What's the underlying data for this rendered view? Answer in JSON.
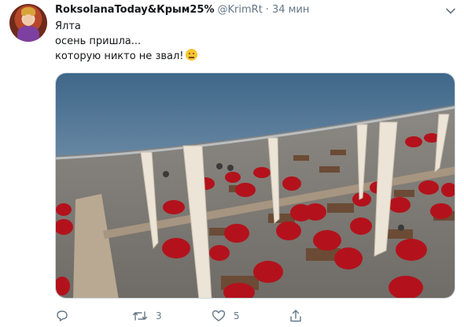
{
  "author": {
    "display_name": "RoksolanaToday&Крым25%",
    "handle": "@KrimRt",
    "separator": "·",
    "time": "34 мин"
  },
  "text": {
    "line1": "Ялта",
    "line2": "осень пришла...",
    "line3": "которую никто не звал!"
  },
  "icons": {
    "avatar": "avatar",
    "caret": "chevron-down-icon",
    "emoji": "neutral-face-emoji",
    "reply": "reply-icon",
    "retweet": "retweet-icon",
    "like": "heart-icon",
    "share": "share-icon"
  },
  "actions": {
    "reply_count": "",
    "retweet_count": "3",
    "like_count": "5"
  },
  "colors": {
    "text_primary": "#14171a",
    "text_secondary": "#657786",
    "border": "#ccd6dd",
    "beanbag_red": "#b3121c",
    "sea": "#4a6f91"
  }
}
